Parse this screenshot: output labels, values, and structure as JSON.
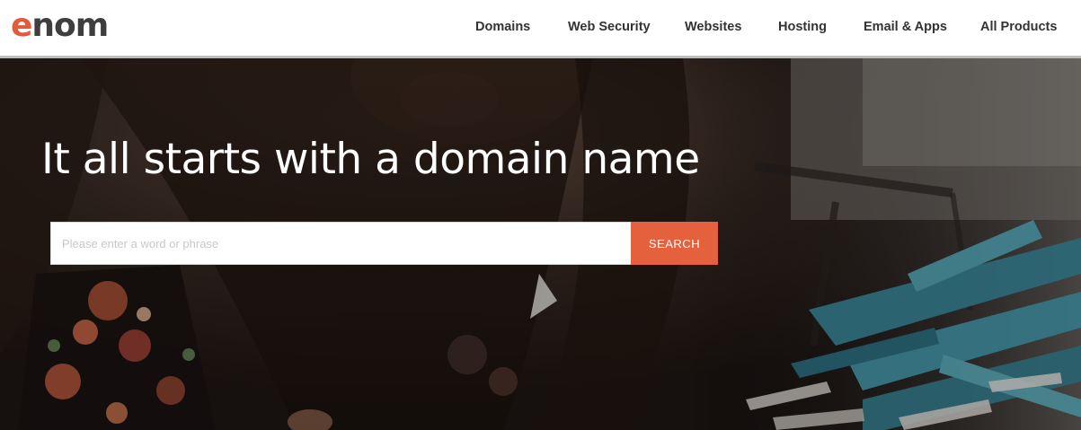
{
  "brand": {
    "logo_first": "e",
    "logo_rest": "nom",
    "accent_color": "#e25b3a",
    "logo_text_color": "#3e3e40"
  },
  "nav": {
    "items": [
      {
        "label": "Domains"
      },
      {
        "label": "Web Security"
      },
      {
        "label": "Websites"
      },
      {
        "label": "Hosting"
      },
      {
        "label": "Email & Apps"
      },
      {
        "label": "All Products"
      }
    ]
  },
  "hero": {
    "title": "It all starts with a domain name",
    "background_description": "Dark photo of a woman with long hair leaning over a table with teal and white paper strips",
    "search": {
      "placeholder": "Please enter a word or phrase",
      "value": "",
      "button_label": "SEARCH",
      "button_color": "#e5603d"
    }
  }
}
